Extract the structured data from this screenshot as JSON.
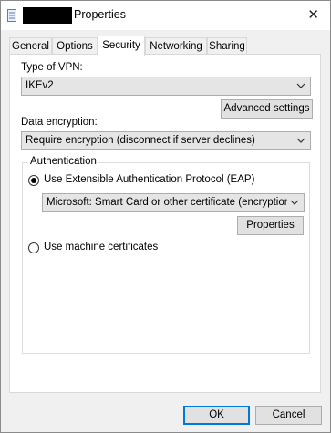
{
  "window": {
    "title": "Properties",
    "close_glyph": "✕"
  },
  "tabs": [
    {
      "label": "General"
    },
    {
      "label": "Options"
    },
    {
      "label": "Security",
      "active": true
    },
    {
      "label": "Networking"
    },
    {
      "label": "Sharing"
    }
  ],
  "vpn": {
    "type_label": "Type of VPN:",
    "type_value": "IKEv2",
    "advanced_button": "Advanced settings",
    "encryption_label": "Data encryption:",
    "encryption_value": "Require encryption (disconnect if server declines)"
  },
  "auth": {
    "group_label": "Authentication",
    "eap_option": "Use Extensible Authentication Protocol (EAP)",
    "eap_selected": true,
    "eap_method": "Microsoft: Smart Card or other certificate (encryption ena",
    "properties_button": "Properties",
    "machine_option": "Use machine certificates"
  },
  "footer": {
    "ok": "OK",
    "cancel": "Cancel"
  },
  "colors": {
    "accent": "#0078d7"
  }
}
